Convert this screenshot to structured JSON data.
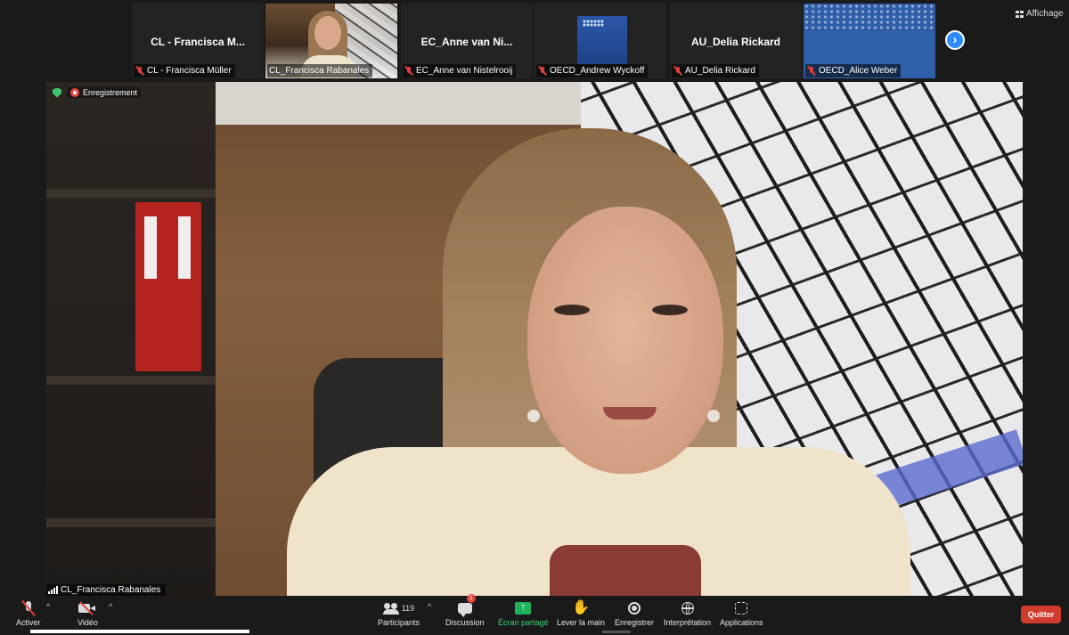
{
  "header": {
    "view_label": "Affichage",
    "view_icon": "grid-icon",
    "next_icon": "chevron-right-icon"
  },
  "gallery": [
    {
      "big_name": "CL - Francisca M...",
      "caption": "CL - Francisca Müller",
      "muted": true,
      "type": "name"
    },
    {
      "big_name": "",
      "caption": "CL_Francisca Rabanales",
      "muted": false,
      "type": "video"
    },
    {
      "big_name": "EC_Anne van Ni...",
      "caption": "EC_Anne van Nistelrooij",
      "muted": true,
      "type": "name"
    },
    {
      "big_name": "",
      "caption": "OECD_Andrew Wyckoff",
      "muted": true,
      "type": "slide"
    },
    {
      "big_name": "AU_Delia Rickard",
      "caption": "AU_Delia Rickard",
      "muted": true,
      "type": "name"
    },
    {
      "big_name": "",
      "caption": "OECD_Alice Weber",
      "muted": true,
      "type": "blue"
    }
  ],
  "main": {
    "recording_label": "Enregistrement",
    "speaker_name": "CL_Francisca Rabanales"
  },
  "toolbar": {
    "unmute_label": "Activer",
    "video_label": "Vidéo",
    "participants_label": "Participants",
    "participants_count": "119",
    "chat_label": "Discussion",
    "chat_badge": "1",
    "share_label": "Écran partagé",
    "raise_hand_label": "Lever la main",
    "record_label": "Enregistrer",
    "interpretation_label": "Interprétation",
    "apps_label": "Applications",
    "quit_label": "Quitter",
    "caret": "^"
  },
  "colors": {
    "accent_blue": "#2d8cff",
    "share_green": "#1fb35b",
    "quit_red": "#d13b2e",
    "mute_red": "#e0403a"
  }
}
